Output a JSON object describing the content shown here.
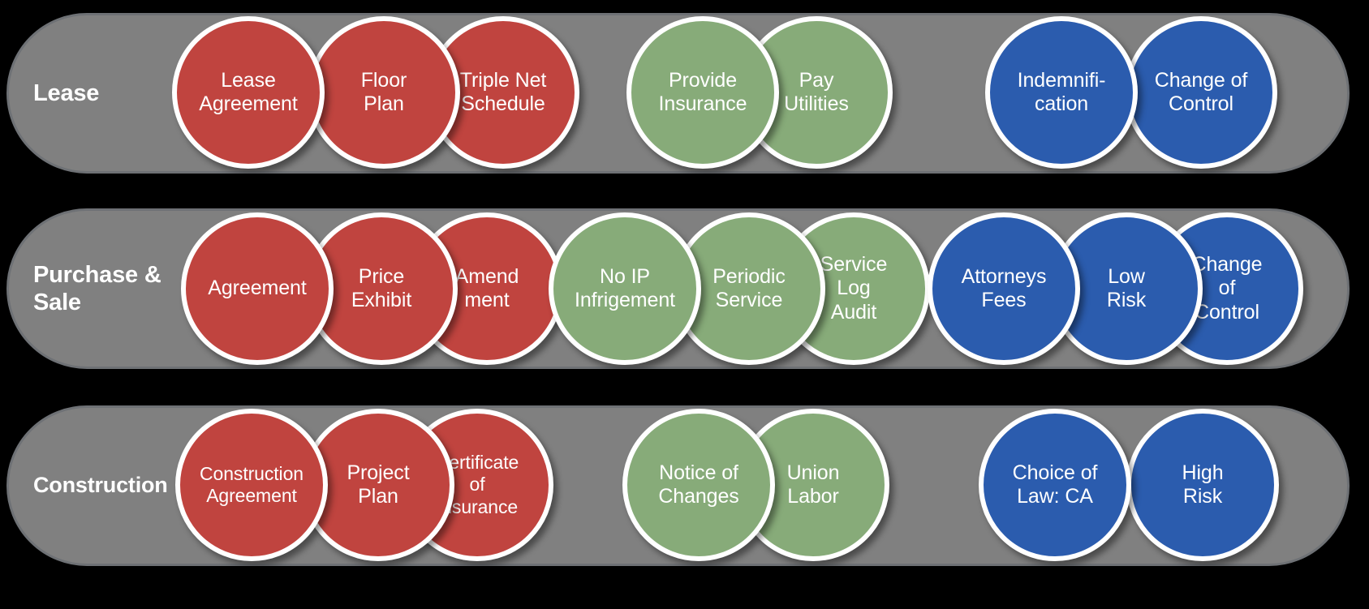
{
  "palette": {
    "background": "#000000",
    "bar_fill": "#808080",
    "bar_border": "#6e7175",
    "red": "#c0443f",
    "green": "#87ab79",
    "blue": "#2b5cae",
    "text": "#ffffff"
  },
  "rows": [
    {
      "id": "lease",
      "label": "Lease",
      "groups": [
        {
          "id": "documents",
          "color": "red",
          "circles": [
            {
              "label": "Lease\nAgreement"
            },
            {
              "label": "Floor\nPlan"
            },
            {
              "label": "Triple Net\nSchedule"
            }
          ]
        },
        {
          "id": "obligations",
          "color": "green",
          "circles": [
            {
              "label": "Provide\nInsurance"
            },
            {
              "label": "Pay\nUtilities"
            }
          ]
        },
        {
          "id": "risk",
          "color": "blue",
          "circles": [
            {
              "label": "Indemnifi-\ncation"
            },
            {
              "label": "Change of\nControl"
            }
          ]
        }
      ]
    },
    {
      "id": "purchase-and-sale",
      "label": "Purchase &\nSale",
      "groups": [
        {
          "id": "documents",
          "color": "red",
          "circles": [
            {
              "label": "Agreement"
            },
            {
              "label": "Price\nExhibit"
            },
            {
              "label": "Amend\nment"
            }
          ]
        },
        {
          "id": "obligations",
          "color": "green",
          "circles": [
            {
              "label": "No IP\nInfrigement"
            },
            {
              "label": "Periodic\nService"
            },
            {
              "label": "Service\nLog\nAudit"
            }
          ]
        },
        {
          "id": "risk",
          "color": "blue",
          "circles": [
            {
              "label": "Attorneys\nFees"
            },
            {
              "label": "Low\nRisk"
            },
            {
              "label": "Change\nof\nControl"
            }
          ]
        }
      ]
    },
    {
      "id": "construction",
      "label": "Construction",
      "groups": [
        {
          "id": "documents",
          "color": "red",
          "circles": [
            {
              "label": "Construction\nAgreement"
            },
            {
              "label": "Project\nPlan"
            },
            {
              "label": "Certificate\nof\nInsurance"
            }
          ]
        },
        {
          "id": "obligations",
          "color": "green",
          "circles": [
            {
              "label": "Notice of\nChanges"
            },
            {
              "label": "Union\nLabor"
            }
          ]
        },
        {
          "id": "risk",
          "color": "blue",
          "circles": [
            {
              "label": "Choice of\nLaw: CA"
            },
            {
              "label": "High\nRisk"
            }
          ]
        }
      ]
    }
  ]
}
